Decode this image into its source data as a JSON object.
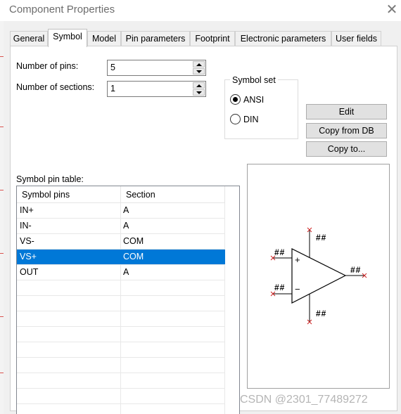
{
  "window": {
    "title": "Component Properties",
    "close_glyph": "✕"
  },
  "tabs": [
    "General",
    "Symbol",
    "Model",
    "Pin parameters",
    "Footprint",
    "Electronic parameters",
    "User fields"
  ],
  "active_tab": "Symbol",
  "fields": {
    "pins_label": "Number of pins:",
    "pins_value": "5",
    "sections_label": "Number of sections:",
    "sections_value": "1"
  },
  "symbol_set": {
    "title": "Symbol set",
    "options": [
      "ANSI",
      "DIN"
    ],
    "selected": "ANSI"
  },
  "buttons": {
    "edit": "Edit",
    "copy_from_db": "Copy from DB",
    "copy_to": "Copy to..."
  },
  "pin_table": {
    "label": "Symbol pin table:",
    "columns": [
      "Symbol pins",
      "Section"
    ],
    "rows": [
      [
        "IN+",
        "A"
      ],
      [
        "IN-",
        "A"
      ],
      [
        "VS-",
        "COM"
      ],
      [
        "VS+",
        "COM"
      ],
      [
        "OUT",
        "A"
      ]
    ],
    "selected_row": 3
  },
  "preview": {
    "pin_mark": "##",
    "plus": "+",
    "minus": "−"
  },
  "watermark": "CSDN @2301_77489272",
  "colors": {
    "selection": "#0078d7",
    "pin_x": "#cc2222"
  }
}
